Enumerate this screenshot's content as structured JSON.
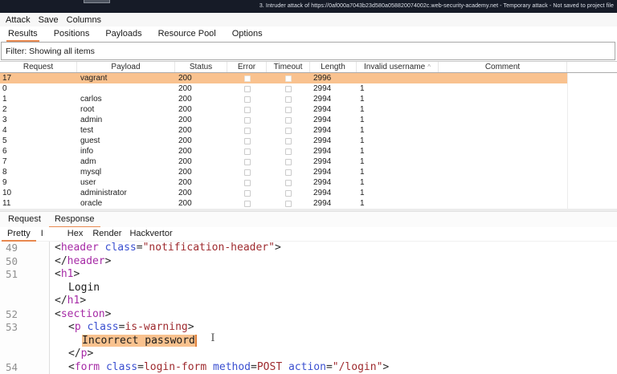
{
  "window": {
    "title": "3. Intruder attack of https://0af000a7043b23d580a058820074002c.web-security-academy.net - Temporary attack - Not saved to project file"
  },
  "menubar": {
    "items": [
      "Attack",
      "Save",
      "Columns"
    ]
  },
  "main_tabs": {
    "items": [
      "Results",
      "Positions",
      "Payloads",
      "Resource Pool",
      "Options"
    ],
    "active_index": 0
  },
  "filter_bar": {
    "text": "Filter: Showing all items"
  },
  "results_table": {
    "columns": [
      "Request",
      "Payload",
      "Status",
      "Error",
      "Timeout",
      "Length",
      "Invalid username",
      "Comment"
    ],
    "sorted_column": "Invalid username",
    "sort_indicator": "^",
    "rows": [
      {
        "request": "17",
        "payload": "vagrant",
        "status": "200",
        "error": false,
        "timeout": false,
        "length": "2996",
        "invalid_username": "",
        "comment": "",
        "selected": true
      },
      {
        "request": "0",
        "payload": "",
        "status": "200",
        "error": false,
        "timeout": false,
        "length": "2994",
        "invalid_username": "1",
        "comment": "",
        "selected": false
      },
      {
        "request": "1",
        "payload": "carlos",
        "status": "200",
        "error": false,
        "timeout": false,
        "length": "2994",
        "invalid_username": "1",
        "comment": "",
        "selected": false
      },
      {
        "request": "2",
        "payload": "root",
        "status": "200",
        "error": false,
        "timeout": false,
        "length": "2994",
        "invalid_username": "1",
        "comment": "",
        "selected": false
      },
      {
        "request": "3",
        "payload": "admin",
        "status": "200",
        "error": false,
        "timeout": false,
        "length": "2994",
        "invalid_username": "1",
        "comment": "",
        "selected": false
      },
      {
        "request": "4",
        "payload": "test",
        "status": "200",
        "error": false,
        "timeout": false,
        "length": "2994",
        "invalid_username": "1",
        "comment": "",
        "selected": false
      },
      {
        "request": "5",
        "payload": "guest",
        "status": "200",
        "error": false,
        "timeout": false,
        "length": "2994",
        "invalid_username": "1",
        "comment": "",
        "selected": false
      },
      {
        "request": "6",
        "payload": "info",
        "status": "200",
        "error": false,
        "timeout": false,
        "length": "2994",
        "invalid_username": "1",
        "comment": "",
        "selected": false
      },
      {
        "request": "7",
        "payload": "adm",
        "status": "200",
        "error": false,
        "timeout": false,
        "length": "2994",
        "invalid_username": "1",
        "comment": "",
        "selected": false
      },
      {
        "request": "8",
        "payload": "mysql",
        "status": "200",
        "error": false,
        "timeout": false,
        "length": "2994",
        "invalid_username": "1",
        "comment": "",
        "selected": false
      },
      {
        "request": "9",
        "payload": "user",
        "status": "200",
        "error": false,
        "timeout": false,
        "length": "2994",
        "invalid_username": "1",
        "comment": "",
        "selected": false
      },
      {
        "request": "10",
        "payload": "administrator",
        "status": "200",
        "error": false,
        "timeout": false,
        "length": "2994",
        "invalid_username": "1",
        "comment": "",
        "selected": false
      },
      {
        "request": "11",
        "payload": "oracle",
        "status": "200",
        "error": false,
        "timeout": false,
        "length": "2994",
        "invalid_username": "1",
        "comment": "",
        "selected": false
      }
    ]
  },
  "message_editor": {
    "tabs": [
      "Request",
      "Response"
    ],
    "active_tab_index": 1,
    "view_tabs": [
      "Pretty",
      "I",
      "Hex",
      "Render",
      "Hackvertor"
    ],
    "active_view_index": 0
  },
  "response_code": {
    "lines": [
      {
        "num": "49",
        "indent": 0,
        "tokens": [
          [
            "pu",
            "<"
          ],
          [
            "tg",
            "header"
          ],
          [
            "tx",
            " "
          ],
          [
            "at",
            "class"
          ],
          [
            "pu",
            "="
          ],
          [
            "vl",
            "\"notification-header\""
          ],
          [
            "pu",
            ">"
          ]
        ]
      },
      {
        "num": "50",
        "indent": 0,
        "tokens": [
          [
            "pu",
            "</"
          ],
          [
            "tg",
            "header"
          ],
          [
            "pu",
            ">"
          ]
        ]
      },
      {
        "num": "51",
        "indent": 0,
        "tokens": [
          [
            "pu",
            "<"
          ],
          [
            "tg",
            "h1"
          ],
          [
            "pu",
            ">"
          ]
        ]
      },
      {
        "num": "",
        "indent": 1,
        "tokens": [
          [
            "tx",
            "Login"
          ]
        ]
      },
      {
        "num": "",
        "indent": 0,
        "tokens": [
          [
            "pu",
            "</"
          ],
          [
            "tg",
            "h1"
          ],
          [
            "pu",
            ">"
          ]
        ]
      },
      {
        "num": "52",
        "indent": 0,
        "tokens": [
          [
            "pu",
            "<"
          ],
          [
            "tg",
            "section"
          ],
          [
            "pu",
            ">"
          ]
        ]
      },
      {
        "num": "53",
        "indent": 1,
        "tokens": [
          [
            "pu",
            "<"
          ],
          [
            "tg",
            "p"
          ],
          [
            "tx",
            " "
          ],
          [
            "at",
            "class"
          ],
          [
            "pu",
            "="
          ],
          [
            "vl",
            "is-warning"
          ],
          [
            "pu",
            ">"
          ]
        ]
      },
      {
        "num": "",
        "indent": 2,
        "tokens": [
          [
            "hl",
            "Incorrect password"
          ]
        ]
      },
      {
        "num": "",
        "indent": 1,
        "tokens": [
          [
            "pu",
            "</"
          ],
          [
            "tg",
            "p"
          ],
          [
            "pu",
            ">"
          ]
        ]
      },
      {
        "num": "54",
        "indent": 1,
        "tokens": [
          [
            "pu",
            "<"
          ],
          [
            "tg",
            "form"
          ],
          [
            "tx",
            " "
          ],
          [
            "at",
            "class"
          ],
          [
            "pu",
            "="
          ],
          [
            "vl",
            "login-form"
          ],
          [
            "tx",
            " "
          ],
          [
            "at",
            "method"
          ],
          [
            "pu",
            "="
          ],
          [
            "vl",
            "POST"
          ],
          [
            "tx",
            " "
          ],
          [
            "at",
            "action"
          ],
          [
            "pu",
            "="
          ],
          [
            "vl",
            "\"/login\""
          ],
          [
            "pu",
            ">"
          ]
        ]
      }
    ]
  },
  "colors": {
    "accent_orange": "#e8884f",
    "selection_orange": "#f9c28f",
    "titlebar_bg": "#161b27",
    "code_tag": "#a62ba6",
    "code_attribute": "#3a4fd0",
    "code_value": "#9e2a2e"
  }
}
